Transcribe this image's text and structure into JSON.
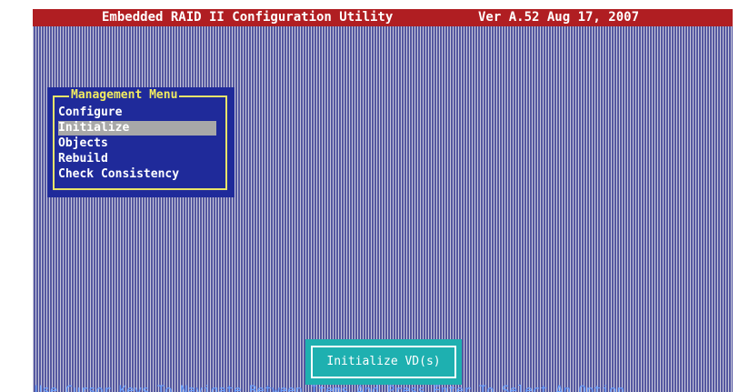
{
  "title_bar": {
    "title": "Embedded RAID II Configuration Utility",
    "version": "Ver A.52 Aug 17, 2007"
  },
  "management_menu": {
    "title": "Management Menu",
    "items": [
      {
        "label": "Configure",
        "selected": false
      },
      {
        "label": "Initialize",
        "selected": true
      },
      {
        "label": "Objects",
        "selected": false
      },
      {
        "label": "Rebuild",
        "selected": false
      },
      {
        "label": "Check Consistency",
        "selected": false
      }
    ]
  },
  "status": {
    "label": "Initialize VD(s)"
  },
  "help_bar": {
    "text": "Use Cursor Keys To Navigate Between Items And Press Enter To Select An Option"
  },
  "colors": {
    "title_bar": "#b01e22",
    "menu_background": "#1f2a9a",
    "menu_border": "#e8e46a",
    "selected_item": "#a8a8a8",
    "status_background": "#1eb0b0"
  }
}
